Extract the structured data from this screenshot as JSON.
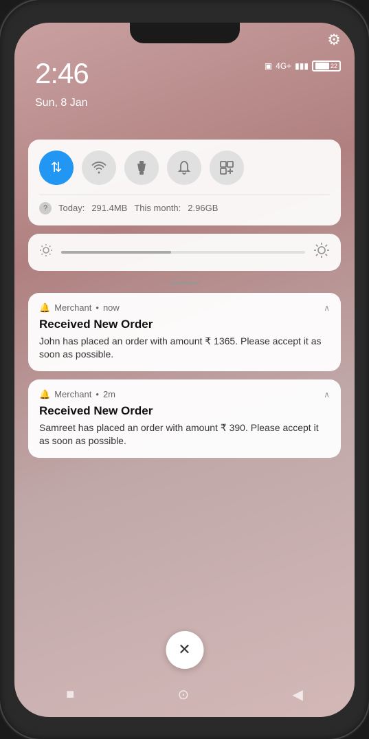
{
  "phone": {
    "time": "2:46",
    "date": "Sun, 8 Jan"
  },
  "status_bar": {
    "signal_text": "4G+",
    "battery_level": "22"
  },
  "quick_toggles": {
    "today_usage_label": "Today:",
    "today_usage_value": "291.4MB",
    "month_usage_label": "This month:",
    "month_usage_value": "2.96GB",
    "buttons": [
      {
        "id": "data",
        "icon": "⇅",
        "active": true
      },
      {
        "id": "wifi",
        "icon": "📶",
        "active": false
      },
      {
        "id": "torch",
        "icon": "🔦",
        "active": false
      },
      {
        "id": "bell",
        "icon": "🔔",
        "active": false
      },
      {
        "id": "screen",
        "icon": "⊠",
        "active": false
      }
    ]
  },
  "brightness": {
    "fill_percent": 45
  },
  "notifications": [
    {
      "id": "notif-1",
      "app": "Merchant",
      "time": "now",
      "title": "Received New Order",
      "body": "John has placed an order with amount ₹ 1365. Please accept it as soon as possible."
    },
    {
      "id": "notif-2",
      "app": "Merchant",
      "time": "2m",
      "title": "Received New Order",
      "body": "Samreet has placed an order with amount ₹ 390. Please accept it as soon as possible."
    }
  ],
  "bottom_nav": {
    "square": "■",
    "circle": "⊙",
    "back": "◀"
  },
  "dismiss": {
    "icon": "✕"
  }
}
